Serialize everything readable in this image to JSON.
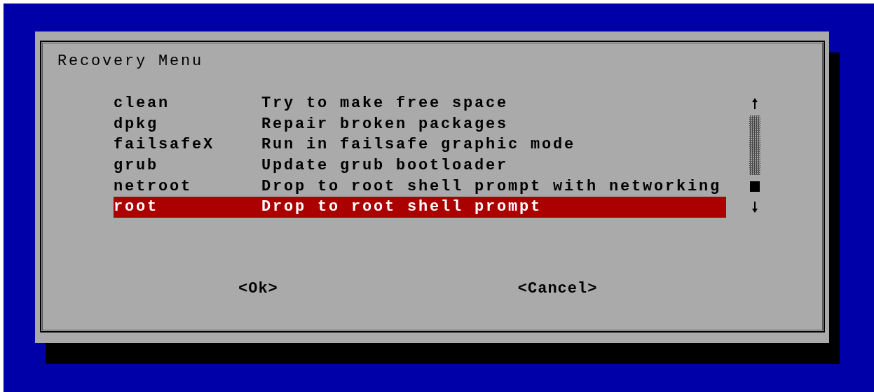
{
  "dialog": {
    "title": "Recovery Menu",
    "items": [
      {
        "name": "clean",
        "description": "Try to make free space",
        "selected": false
      },
      {
        "name": "dpkg",
        "description": "Repair broken packages",
        "selected": false
      },
      {
        "name": "failsafeX",
        "description": "Run in failsafe graphic mode",
        "selected": false
      },
      {
        "name": "grub",
        "description": "Update grub bootloader",
        "selected": false
      },
      {
        "name": "netroot",
        "description": "Drop to root shell prompt with networking",
        "selected": false
      },
      {
        "name": "root",
        "description": "Drop to root shell prompt",
        "selected": true
      }
    ],
    "buttons": [
      "<Ok>",
      "<Cancel>"
    ]
  }
}
